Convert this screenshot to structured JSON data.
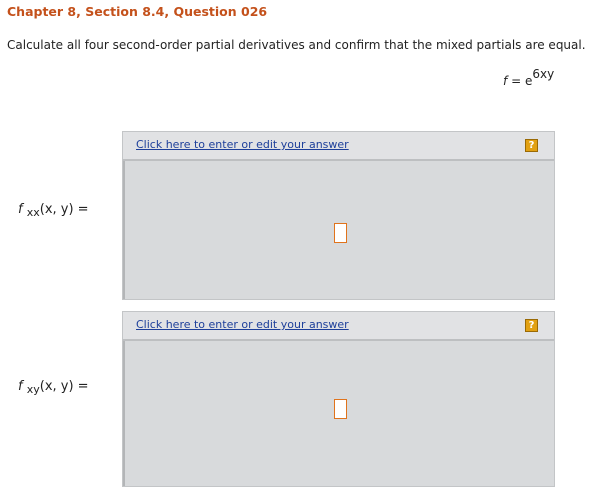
{
  "header": {
    "chapter_title": "Chapter 8, Section 8.4, Question 026",
    "question": "Calculate all four second-order partial derivatives and confirm that the mixed partials are equal."
  },
  "function": {
    "lhs": "f",
    "equals": "=",
    "base": "e",
    "exponent": "6xy"
  },
  "answers": [
    {
      "func": "f",
      "subscript": "xx",
      "args": "(x, y) =",
      "link_text": "Click here to enter or edit your answer",
      "help_icon": "?"
    },
    {
      "func": "f",
      "subscript": "xy",
      "args": "(x, y) =",
      "link_text": "Click here to enter or edit your answer",
      "help_icon": "?"
    }
  ],
  "colors": {
    "title": "#c4511b",
    "link": "#1d3f9a",
    "help_icon": "#e2a112",
    "answer_slot_border": "#e0731c",
    "box_bg": "#d8dadc"
  }
}
